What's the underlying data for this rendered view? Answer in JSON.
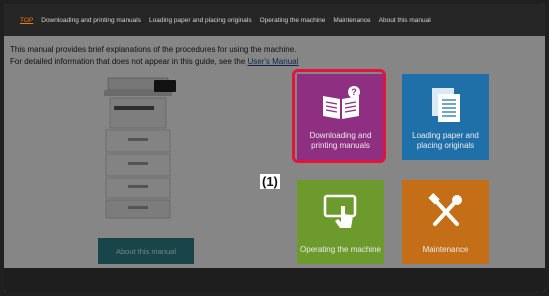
{
  "nav": {
    "items": [
      {
        "label": "TOP",
        "active": true
      },
      {
        "label": "Downloading and printing manuals",
        "active": false
      },
      {
        "label": "Loading paper and placing originals",
        "active": false
      },
      {
        "label": "Operating the machine",
        "active": false
      },
      {
        "label": "Maintenance",
        "active": false
      },
      {
        "label": "About this manual",
        "active": false
      }
    ]
  },
  "intro": {
    "line1": "This manual provides brief explanations of the procedures for using the machine.",
    "line2": "For detailed information that does not appear in this guide, see the ",
    "link": "User's Manual"
  },
  "about_button": "About this manual",
  "tiles": {
    "download": "Downloading and printing manuals",
    "loading": "Loading paper and placing originals",
    "operating": "Operating the machine",
    "maintenance": "Maintenance"
  },
  "callout": "(1)",
  "colors": {
    "download": "#8e2f82",
    "loading": "#1f6fa8",
    "operating": "#6d9a2c",
    "maintenance": "#c46f17",
    "highlight": "#e3143c",
    "nav_active": "#f07a00"
  },
  "icons": [
    "book-question-icon",
    "documents-icon",
    "touch-screen-icon",
    "tools-icon"
  ]
}
